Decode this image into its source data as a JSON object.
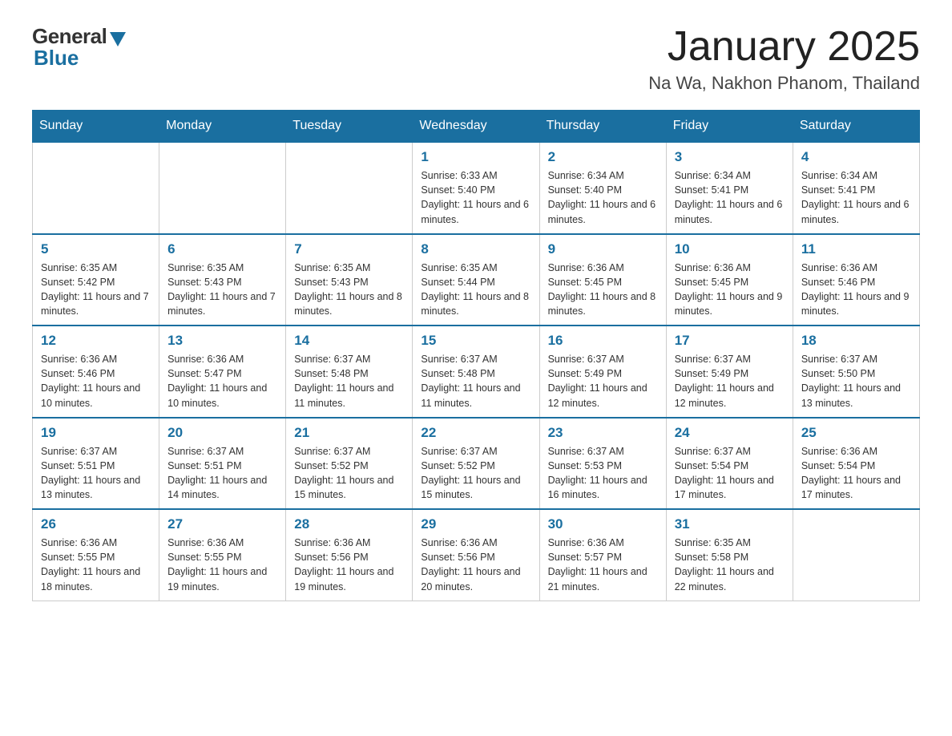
{
  "header": {
    "logo_general": "General",
    "logo_blue": "Blue",
    "month_title": "January 2025",
    "location": "Na Wa, Nakhon Phanom, Thailand"
  },
  "weekdays": [
    "Sunday",
    "Monday",
    "Tuesday",
    "Wednesday",
    "Thursday",
    "Friday",
    "Saturday"
  ],
  "weeks": [
    [
      {
        "day": "",
        "info": ""
      },
      {
        "day": "",
        "info": ""
      },
      {
        "day": "",
        "info": ""
      },
      {
        "day": "1",
        "info": "Sunrise: 6:33 AM\nSunset: 5:40 PM\nDaylight: 11 hours and 6 minutes."
      },
      {
        "day": "2",
        "info": "Sunrise: 6:34 AM\nSunset: 5:40 PM\nDaylight: 11 hours and 6 minutes."
      },
      {
        "day": "3",
        "info": "Sunrise: 6:34 AM\nSunset: 5:41 PM\nDaylight: 11 hours and 6 minutes."
      },
      {
        "day": "4",
        "info": "Sunrise: 6:34 AM\nSunset: 5:41 PM\nDaylight: 11 hours and 6 minutes."
      }
    ],
    [
      {
        "day": "5",
        "info": "Sunrise: 6:35 AM\nSunset: 5:42 PM\nDaylight: 11 hours and 7 minutes."
      },
      {
        "day": "6",
        "info": "Sunrise: 6:35 AM\nSunset: 5:43 PM\nDaylight: 11 hours and 7 minutes."
      },
      {
        "day": "7",
        "info": "Sunrise: 6:35 AM\nSunset: 5:43 PM\nDaylight: 11 hours and 8 minutes."
      },
      {
        "day": "8",
        "info": "Sunrise: 6:35 AM\nSunset: 5:44 PM\nDaylight: 11 hours and 8 minutes."
      },
      {
        "day": "9",
        "info": "Sunrise: 6:36 AM\nSunset: 5:45 PM\nDaylight: 11 hours and 8 minutes."
      },
      {
        "day": "10",
        "info": "Sunrise: 6:36 AM\nSunset: 5:45 PM\nDaylight: 11 hours and 9 minutes."
      },
      {
        "day": "11",
        "info": "Sunrise: 6:36 AM\nSunset: 5:46 PM\nDaylight: 11 hours and 9 minutes."
      }
    ],
    [
      {
        "day": "12",
        "info": "Sunrise: 6:36 AM\nSunset: 5:46 PM\nDaylight: 11 hours and 10 minutes."
      },
      {
        "day": "13",
        "info": "Sunrise: 6:36 AM\nSunset: 5:47 PM\nDaylight: 11 hours and 10 minutes."
      },
      {
        "day": "14",
        "info": "Sunrise: 6:37 AM\nSunset: 5:48 PM\nDaylight: 11 hours and 11 minutes."
      },
      {
        "day": "15",
        "info": "Sunrise: 6:37 AM\nSunset: 5:48 PM\nDaylight: 11 hours and 11 minutes."
      },
      {
        "day": "16",
        "info": "Sunrise: 6:37 AM\nSunset: 5:49 PM\nDaylight: 11 hours and 12 minutes."
      },
      {
        "day": "17",
        "info": "Sunrise: 6:37 AM\nSunset: 5:49 PM\nDaylight: 11 hours and 12 minutes."
      },
      {
        "day": "18",
        "info": "Sunrise: 6:37 AM\nSunset: 5:50 PM\nDaylight: 11 hours and 13 minutes."
      }
    ],
    [
      {
        "day": "19",
        "info": "Sunrise: 6:37 AM\nSunset: 5:51 PM\nDaylight: 11 hours and 13 minutes."
      },
      {
        "day": "20",
        "info": "Sunrise: 6:37 AM\nSunset: 5:51 PM\nDaylight: 11 hours and 14 minutes."
      },
      {
        "day": "21",
        "info": "Sunrise: 6:37 AM\nSunset: 5:52 PM\nDaylight: 11 hours and 15 minutes."
      },
      {
        "day": "22",
        "info": "Sunrise: 6:37 AM\nSunset: 5:52 PM\nDaylight: 11 hours and 15 minutes."
      },
      {
        "day": "23",
        "info": "Sunrise: 6:37 AM\nSunset: 5:53 PM\nDaylight: 11 hours and 16 minutes."
      },
      {
        "day": "24",
        "info": "Sunrise: 6:37 AM\nSunset: 5:54 PM\nDaylight: 11 hours and 17 minutes."
      },
      {
        "day": "25",
        "info": "Sunrise: 6:36 AM\nSunset: 5:54 PM\nDaylight: 11 hours and 17 minutes."
      }
    ],
    [
      {
        "day": "26",
        "info": "Sunrise: 6:36 AM\nSunset: 5:55 PM\nDaylight: 11 hours and 18 minutes."
      },
      {
        "day": "27",
        "info": "Sunrise: 6:36 AM\nSunset: 5:55 PM\nDaylight: 11 hours and 19 minutes."
      },
      {
        "day": "28",
        "info": "Sunrise: 6:36 AM\nSunset: 5:56 PM\nDaylight: 11 hours and 19 minutes."
      },
      {
        "day": "29",
        "info": "Sunrise: 6:36 AM\nSunset: 5:56 PM\nDaylight: 11 hours and 20 minutes."
      },
      {
        "day": "30",
        "info": "Sunrise: 6:36 AM\nSunset: 5:57 PM\nDaylight: 11 hours and 21 minutes."
      },
      {
        "day": "31",
        "info": "Sunrise: 6:35 AM\nSunset: 5:58 PM\nDaylight: 11 hours and 22 minutes."
      },
      {
        "day": "",
        "info": ""
      }
    ]
  ]
}
